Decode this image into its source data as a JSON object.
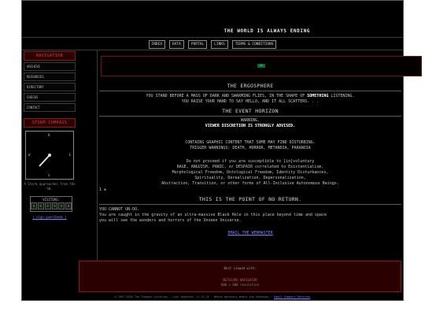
{
  "site": {
    "title": "THE WORLD IS ALWAYS ENDING"
  },
  "nav": [
    "INDEX",
    "DATA",
    "PORTAL",
    "LINKS",
    "TERMS & CONDITIONS"
  ],
  "sidebar": {
    "nav_head": "NAVIGATION",
    "items": [
      "ARCHIVE",
      "RESOURCES",
      "DIRECTORY",
      "CHECKS",
      "CONTACT"
    ],
    "compass_head": "STORM COMPASS",
    "clock_ticks": {
      "n": "N",
      "e": "E",
      "s": "S",
      "w": "W"
    },
    "storm_caption": "A Storm approaches from the SW.",
    "visitors_label": "VISITORS:",
    "visitor_digits": [
      "0",
      "0",
      "0",
      "0",
      "0",
      "0"
    ],
    "guestbook": "| sign guestbook |"
  },
  "main": {
    "banner_badge": "OK",
    "ergosphere_title": "THE ERGOSPHERE",
    "ergo_line1_pre": "YOU STAND BEFORE A MASS OF DARK AND SWARMING FLIES, IN THE SHAPE OF",
    "ergo_line1_bold": "SOMETHING",
    "ergo_line1_post": "LISTENING.",
    "ergo_line2": "YOU RAISE YOUR HAND TO SAY HELLO, AND IT ALL SCATTERS. . .",
    "horizon_title": "THE EVENT HORIZON",
    "warning": "WARNING.",
    "viewer_discretion": "VIEWER DISCRETION IS STRONGLY ADVISED.",
    "content_warning": "CONTAINS GRAPHIC CONTENT THAT SOME MAY FIND DISTURBING.",
    "trigger_warnings": "TRIGGER WARNINGS: DEATH, HORROR, METANOIA, PARANOIA",
    "proceed_lines": [
      "Do not proceed if you are susceptible to [in]voluntary",
      "RAGE, ANGUISH, PANIC, or DESPAIR correlated to Existentialism,",
      "Morphological Freedom, Ontological Freedom, Identity Disturbances,",
      "Spirituality, Derealization, Depersonalization,",
      "Abstraction, Transition, or other forms of All-Inclusive Autonomous Beings."
    ],
    "marker": "1 ±",
    "no_return_title": "THIS IS THE POINT OF NO RETURN.",
    "undo": "YOU CANNOT UN-DO.",
    "caught_lines": [
      "You are caught in the gravity of an ultra-massive Black Hole in this place beyond time and space",
      "you will see the wonders and horrors of the Unseen Universe."
    ],
    "email_link": "EMAIL THE WEBMASTER"
  },
  "footer_box": {
    "line1": "Best viewed with:",
    "line2": "NETSCAPE NAVIGATOR",
    "line3": "800 x 600 resolution"
  },
  "bottombar": {
    "text": "© 1997-2026 The Tempest Archives · Last Updated: 11.11.25 · Where darkness meets the Unknowns ·",
    "link": "Email Support Services"
  }
}
